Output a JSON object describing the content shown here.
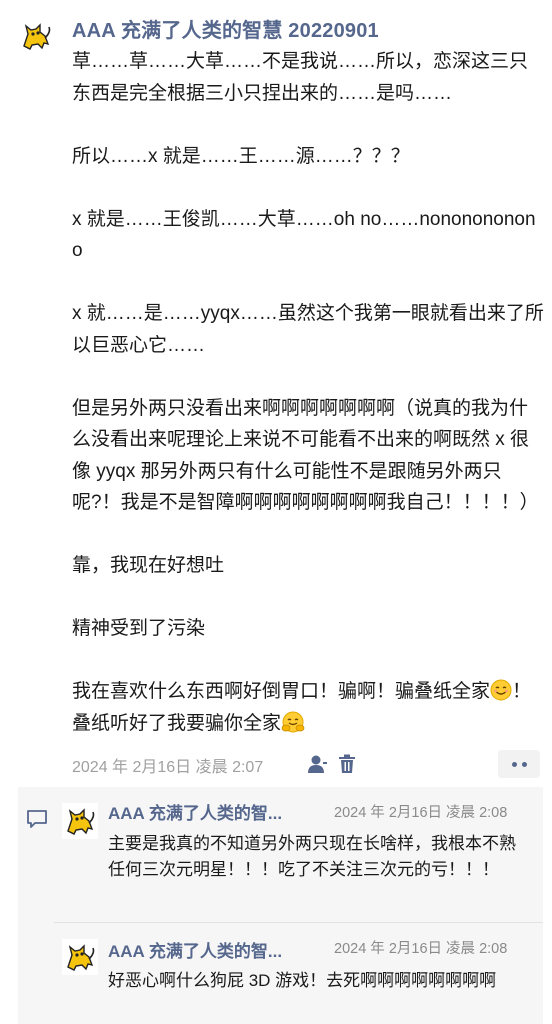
{
  "post": {
    "author": "AAA 充满了人类的智慧 20220901",
    "paragraphs": [
      "草……草……大草……不是我说……所以，恋深这三只东西是完全根据三小只捏出来的……是吗……",
      "所以……x 就是……王……源……？？？",
      "x 就是……王俊凯……大草……oh no……nononononono",
      "x 就……是……yyqx……虽然这个我第一眼就看出来了所以巨恶心它……",
      "但是另外两只没看出来啊啊啊啊啊啊啊（说真的我为什么没看出来呢理论上来说不可能看不出来的啊既然 x 很像 yyqx 那另外两只有什么可能性不是跟随另外两只呢?！我是不是智障啊啊啊啊啊啊啊啊我自己！！！！）",
      "靠，我现在好想吐",
      "精神受到了污染"
    ],
    "last_paragraph_parts": {
      "a": "我在喜欢什么东西啊好倒胃口！骗啊！骗叠纸全家",
      "b": "！叠纸听好了我要骗你全家"
    },
    "timestamp": "2024 年 2月16日 凌晨 2:07",
    "icons": [
      "profile-icon",
      "trash-icon",
      "more-icon"
    ]
  },
  "comments": [
    {
      "author": "AAA 充满了人类的智...",
      "time": "2024 年 2月16日 凌晨 2:08",
      "text": "主要是我真的不知道另外两只现在长啥样，我根本不熟任何三次元明星！！！吃了不关注三次元的亏！！！"
    },
    {
      "author": "AAA 充满了人类的智...",
      "time": "2024 年 2月16日 凌晨 2:08",
      "text": "好恶心啊什么狗屁 3D 游戏！去死啊啊啊啊啊啊啊啊"
    }
  ],
  "colors": {
    "author": "#56678d",
    "meta": "#a0a0a0",
    "comment_bg": "#f6f6f6"
  }
}
